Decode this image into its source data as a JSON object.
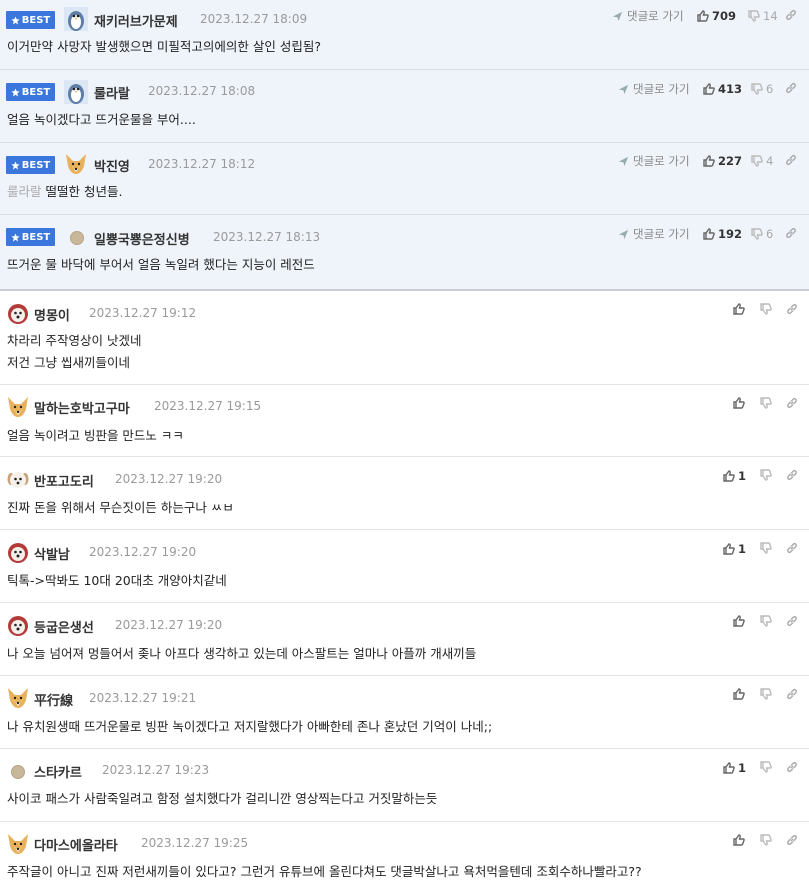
{
  "best_comments": [
    {
      "badge": "BEST",
      "nick": "재키러브가문제",
      "time": "2023.12.27 18:09",
      "text": "이거만약 사망자 발생했으면 미필적고의에의한 살인 성립됨?",
      "goto": "댓글로 가기",
      "likes": "709",
      "dislikes": "14",
      "avatar": "penguin-icon"
    },
    {
      "badge": "BEST",
      "nick": "룰라랄",
      "time": "2023.12.27 18:08",
      "text": "얼음 녹이겠다고 뜨거운물을 부어....",
      "goto": "댓글로 가기",
      "likes": "413",
      "dislikes": "6",
      "avatar": "penguin-icon"
    },
    {
      "badge": "BEST",
      "nick": "박진영",
      "time": "2023.12.27 18:12",
      "reply_to": "룰라랄",
      "text": "떨떨한 청년들.",
      "goto": "댓글로 가기",
      "likes": "227",
      "dislikes": "4",
      "avatar": "fox-icon"
    },
    {
      "badge": "BEST",
      "nick": "일뿅국뿅은정신병",
      "time": "2023.12.27 18:13",
      "text": "뜨거운 물 바닥에 부어서 얼음 녹일려 했다는 지능이 레전드",
      "goto": "댓글로 가기",
      "likes": "192",
      "dislikes": "6",
      "avatar": "dot-icon"
    }
  ],
  "comments": [
    {
      "nick": "명몽이",
      "time": "2023.12.27 19:12",
      "lines": [
        "차라리 주작영상이 낫겠네",
        "저건 그냥 씹새끼들이네"
      ],
      "likes": "",
      "avatar": "dog-red-icon"
    },
    {
      "nick": "말하는호박고구마",
      "time": "2023.12.27 19:15",
      "lines": [
        "얼음 녹이려고 빙판을 만드노 ㅋㅋ"
      ],
      "likes": "",
      "avatar": "fox-icon"
    },
    {
      "nick": "반포고도리",
      "time": "2023.12.27 19:20",
      "lines": [
        "진짜 돈을 위해서 무슨짓이든 하는구나 ㅆㅂ"
      ],
      "likes": "1",
      "avatar": "puppy-icon"
    },
    {
      "nick": "삭발남",
      "time": "2023.12.27 19:20",
      "lines": [
        "틱톡->딱봐도 10대 20대초 개양아치같네"
      ],
      "likes": "1",
      "avatar": "dog-red-icon"
    },
    {
      "nick": "등굽은생선",
      "time": "2023.12.27 19:20",
      "lines": [
        "나 오늘 넘어져 멍들어서 좆나 아프다 생각하고 있는데 아스팔트는 얼마나 아플까 개새끼들"
      ],
      "likes": "",
      "avatar": "dog-red-icon"
    },
    {
      "nick": "平行線",
      "time": "2023.12.27 19:21",
      "lines": [
        "나 유치원생때 뜨거운물로 빙판 녹이겠다고 저지랄했다가 아빠한테 존나 혼났던 기억이 나네;;"
      ],
      "likes": "",
      "avatar": "fox-icon"
    },
    {
      "nick": "스타카르",
      "time": "2023.12.27 19:23",
      "lines": [
        "사이코 패스가 사람죽일려고 함정 설치했다가 걸리니깐 영상찍는다고 거짓말하는듯"
      ],
      "likes": "1",
      "avatar": "dot-icon"
    },
    {
      "nick": "다마스에올라타",
      "time": "2023.12.27 19:25",
      "lines": [
        "주작글이 아니고 진짜 저런새끼들이 있다고? 그런거 유튜브에 올린다쳐도 댓글박살나고 욕처먹을텐데 조회수하나빨라고??"
      ],
      "likes": "",
      "avatar": "fox-icon"
    }
  ]
}
